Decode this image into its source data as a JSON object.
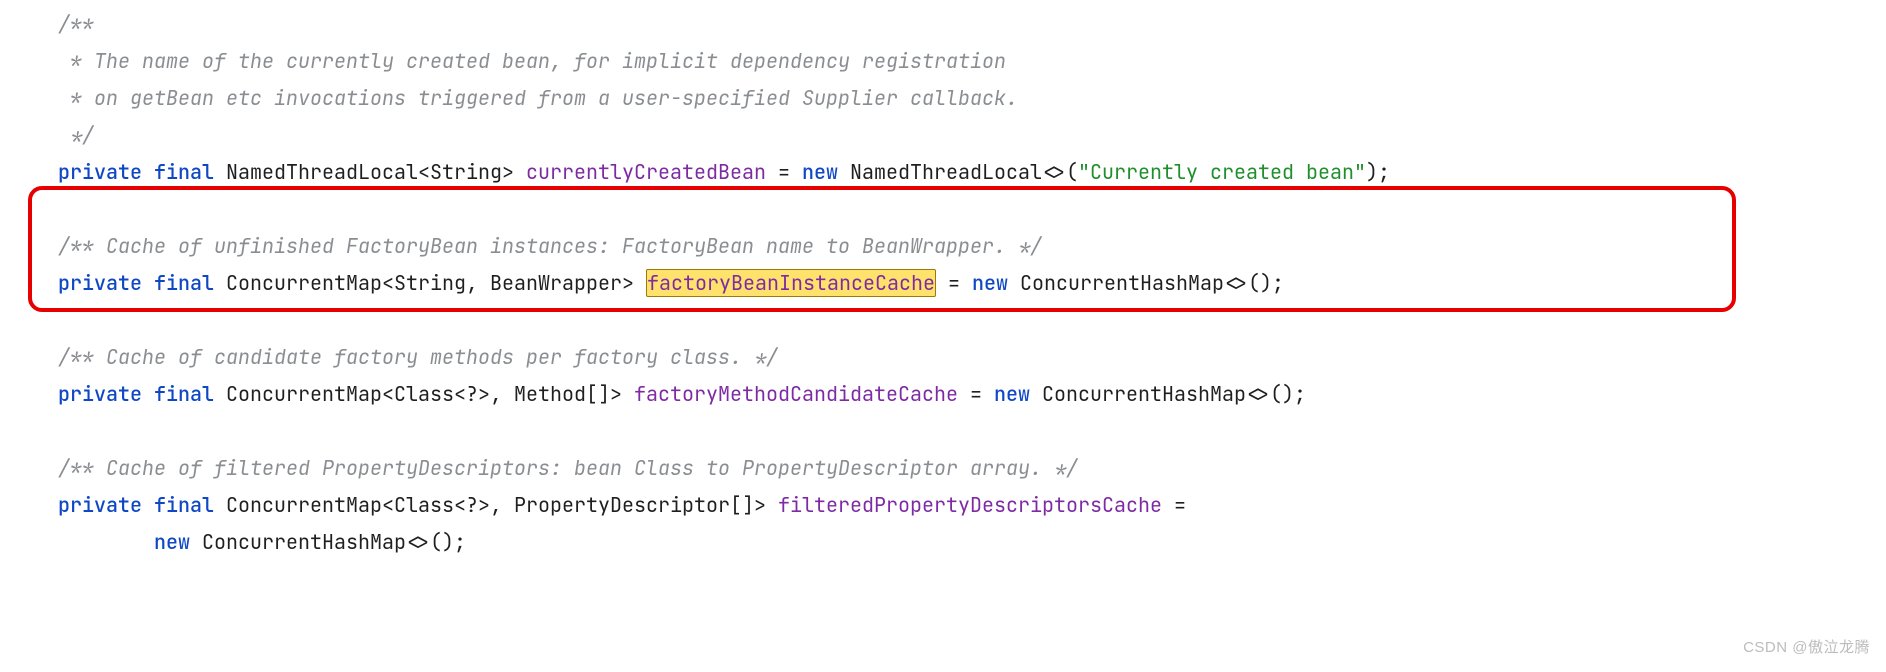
{
  "code": {
    "c1_l1": "/**",
    "c1_l2": " * The name of the currently created bean, for implicit dependency registration",
    "c1_l3": " * on getBean etc invocations triggered from a user-specified Supplier callback.",
    "c1_l4": " */",
    "kw_private": "private",
    "kw_final": "final",
    "kw_new": "new",
    "decl1_type": " NamedThreadLocal<String> ",
    "decl1_field": "currentlyCreatedBean",
    "decl1_assign": " = ",
    "decl1_ctor": " NamedThreadLocal<>(",
    "decl1_str": "\"Currently created bean\"",
    "decl1_end": ");",
    "c2": "/** Cache of unfinished FactoryBean instances: FactoryBean name to BeanWrapper. */",
    "decl2_type": " ConcurrentMap<String, BeanWrapper> ",
    "decl2_field": "factoryBeanInstanceCache",
    "decl2_assign": " = ",
    "decl2_ctor": " ConcurrentHashMap<>();",
    "c3": "/** Cache of candidate factory methods per factory class. */",
    "decl3_type": " ConcurrentMap<Class<?>, Method[]> ",
    "decl3_field": "factoryMethodCandidateCache",
    "decl3_assign": " = ",
    "decl3_ctor": " ConcurrentHashMap<>();",
    "c4": "/** Cache of filtered PropertyDescriptors: bean Class to PropertyDescriptor array. */",
    "decl4_type": " ConcurrentMap<Class<?>, PropertyDescriptor[]> ",
    "decl4_field": "filteredPropertyDescriptorsCache",
    "decl4_assign": " =",
    "decl4_ctor": " ConcurrentHashMap<>();"
  },
  "watermark": "CSDN @傲泣龙腾"
}
